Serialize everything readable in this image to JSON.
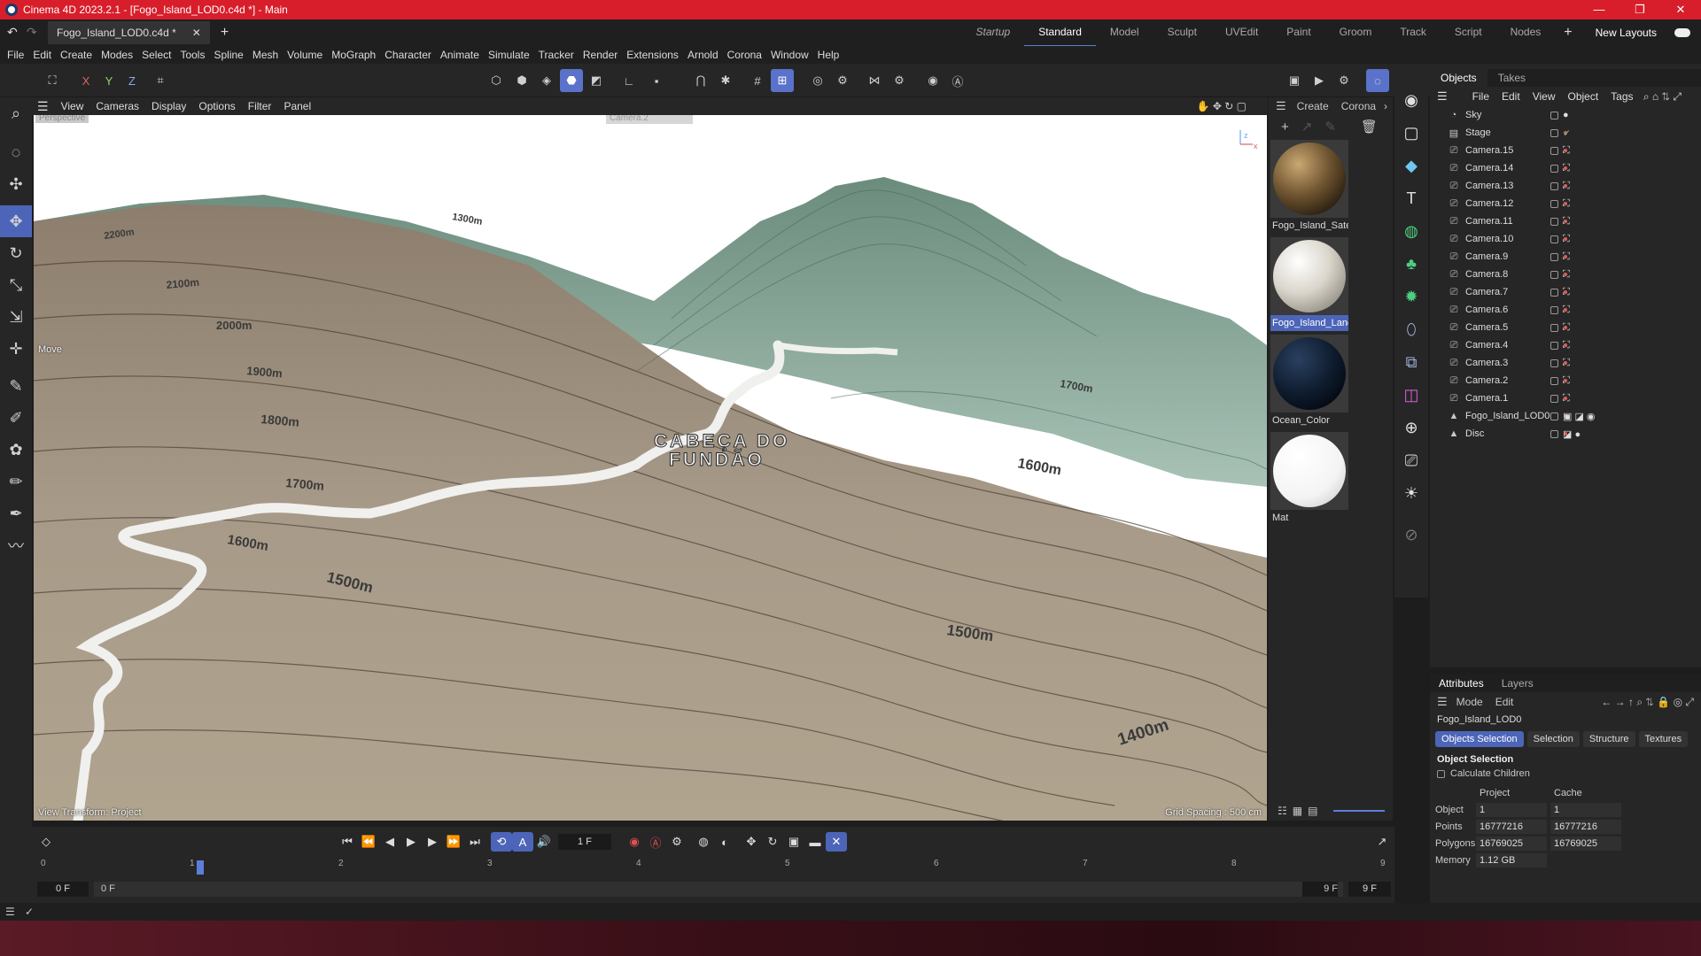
{
  "window": {
    "title": "Cinema 4D 2023.2.1 - [Fogo_Island_LOD0.c4d *] - Main",
    "min": "—",
    "max": "❐",
    "close": "✕"
  },
  "tabbar": {
    "doc_tab": "Fogo_Island_LOD0.c4d *",
    "layouts": [
      "Startup",
      "Standard",
      "Model",
      "Sculpt",
      "UVEdit",
      "Paint",
      "Groom",
      "Track",
      "Script",
      "Nodes"
    ],
    "active_layout": "Standard",
    "new_layouts": "New Layouts"
  },
  "menu": [
    "File",
    "Edit",
    "Create",
    "Modes",
    "Select",
    "Tools",
    "Spline",
    "Mesh",
    "Volume",
    "MoGraph",
    "Character",
    "Animate",
    "Simulate",
    "Tracker",
    "Render",
    "Extensions",
    "Arnold",
    "Corona",
    "Window",
    "Help"
  ],
  "toolbar": {
    "x": "X",
    "y": "Y",
    "z": "Z"
  },
  "viewport": {
    "menu": [
      "View",
      "Cameras",
      "Display",
      "Options",
      "Filter",
      "Panel"
    ],
    "label_perspective": "Perspective",
    "camera_dropdown": "Camera.2",
    "move_label": "Move",
    "view_transform": "View Transform: Project",
    "grid_spacing": "Grid Spacing : 500 cm",
    "map_label_line1": "CABEÇA DO",
    "map_label_line2": "FUNDÃO",
    "contours": [
      "2200m",
      "2100m",
      "2000m",
      "1900m",
      "1800m",
      "1700m",
      "1600m",
      "1600m",
      "1500m",
      "1500m",
      "1400m",
      "1700m",
      "1300m"
    ]
  },
  "materials": {
    "menu": [
      "Create",
      "Corona"
    ],
    "items": [
      {
        "name": "Fogo_Island_Satel",
        "selected": false
      },
      {
        "name": "Fogo_Island_Land",
        "selected": true
      },
      {
        "name": "Ocean_Color",
        "selected": false
      },
      {
        "name": "Mat",
        "selected": false
      }
    ]
  },
  "objects": {
    "tabs": [
      "Objects",
      "Takes"
    ],
    "menu": [
      "File",
      "Edit",
      "View",
      "Object",
      "Tags"
    ],
    "items": [
      {
        "name": "Sky",
        "icon": "sky-icon"
      },
      {
        "name": "Stage",
        "icon": "stage-icon"
      },
      {
        "name": "Camera.15",
        "icon": "camera-icon"
      },
      {
        "name": "Camera.14",
        "icon": "camera-icon"
      },
      {
        "name": "Camera.13",
        "icon": "camera-icon"
      },
      {
        "name": "Camera.12",
        "icon": "camera-icon"
      },
      {
        "name": "Camera.11",
        "icon": "camera-icon"
      },
      {
        "name": "Camera.10",
        "icon": "camera-icon"
      },
      {
        "name": "Camera.9",
        "icon": "camera-icon"
      },
      {
        "name": "Camera.8",
        "icon": "camera-icon"
      },
      {
        "name": "Camera.7",
        "icon": "camera-icon"
      },
      {
        "name": "Camera.6",
        "icon": "camera-icon"
      },
      {
        "name": "Camera.5",
        "icon": "camera-icon"
      },
      {
        "name": "Camera.4",
        "icon": "camera-icon"
      },
      {
        "name": "Camera.3",
        "icon": "camera-icon"
      },
      {
        "name": "Camera.2",
        "icon": "camera-icon"
      },
      {
        "name": "Camera.1",
        "icon": "camera-icon"
      },
      {
        "name": "Fogo_Island_LOD0",
        "icon": "polygon-object-icon"
      },
      {
        "name": "Disc",
        "icon": "disc-icon"
      }
    ]
  },
  "attributes": {
    "tabs": [
      "Attributes",
      "Layers"
    ],
    "menu": [
      "Mode",
      "Edit"
    ],
    "object_name": "Fogo_Island_LOD0",
    "subtabs": [
      "Objects Selection",
      "Selection",
      "Structure",
      "Textures"
    ],
    "section": "Object Selection",
    "calc_children": "Calculate Children",
    "col_project": "Project",
    "col_cache": "Cache",
    "rows": [
      {
        "label": "Object",
        "project": "1",
        "cache": "1"
      },
      {
        "label": "Points",
        "project": "16777216",
        "cache": "16777216"
      },
      {
        "label": "Polygons",
        "project": "16769025",
        "cache": "16769025"
      },
      {
        "label": "Memory",
        "project": "1.12 GB",
        "cache": ""
      }
    ]
  },
  "timeline": {
    "current_frame": "1 F",
    "start": "0 F",
    "range_start": "0 F",
    "range_end": "9 F",
    "end": "9 F",
    "ticks": [
      "1",
      "2",
      "3",
      "4",
      "5",
      "6",
      "7",
      "8",
      "9"
    ]
  },
  "colors": {
    "accent": "#4c65b8",
    "titlebar": "#d81e2b",
    "terrain": "#a39785",
    "terrain_green": "#7a9a8a"
  }
}
